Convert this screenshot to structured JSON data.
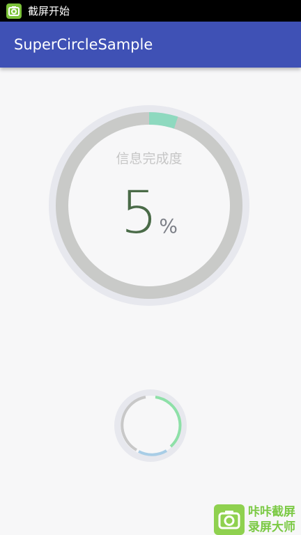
{
  "status_bar": {
    "text": "截屏开始"
  },
  "app_bar": {
    "title": "SuperCircleSample"
  },
  "progress_circle": {
    "label": "信息完成度",
    "value": "5",
    "unit": "%",
    "progress_fraction": 0.05,
    "colors": {
      "outer_ring": "#e7e8ee",
      "track": "#c9cac8",
      "progress": "#8ed9bf",
      "value_text": "#4a6b48"
    }
  },
  "loading_circle": {
    "colors": {
      "ring": "#e7e8ee",
      "green": "#8ee0a8",
      "gray": "#c8c8c8",
      "blue": "#a8cde6"
    }
  },
  "watermark": {
    "line1": "咔咔截屏",
    "line2": "录屏大师",
    "icon": "camera-icon"
  }
}
